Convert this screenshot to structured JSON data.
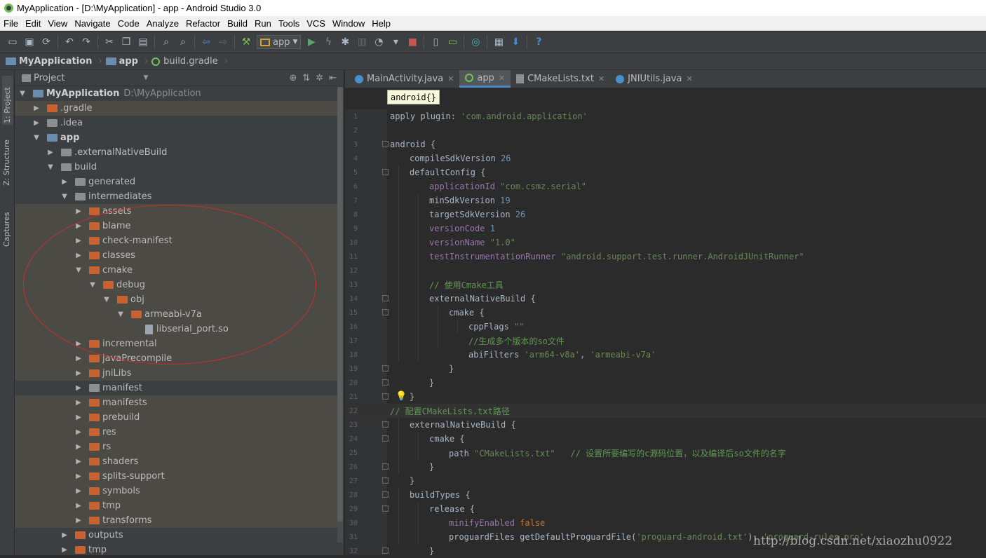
{
  "window": {
    "title": "MyApplication - [D:\\MyApplication] - app - Android Studio 3.0"
  },
  "menu": [
    "File",
    "Edit",
    "View",
    "Navigate",
    "Code",
    "Analyze",
    "Refactor",
    "Build",
    "Run",
    "Tools",
    "VCS",
    "Window",
    "Help"
  ],
  "toolbar": {
    "run_config": "app",
    "help": "?"
  },
  "breadcrumb": {
    "project": "MyApplication",
    "module": "app",
    "file": "build.gradle"
  },
  "side_tabs": {
    "project": "1: Project",
    "structure": "Z: Structure",
    "captures": "Captures"
  },
  "project_panel": {
    "view": "Project"
  },
  "tree": [
    {
      "label": "MyApplication",
      "path": "D:\\MyApplication",
      "depth": 0,
      "state": "open",
      "icon": "module"
    },
    {
      "label": ".gradle",
      "depth": 1,
      "state": "closed",
      "icon": "orange-folder"
    },
    {
      "label": ".idea",
      "depth": 1,
      "state": "closed",
      "icon": "folder"
    },
    {
      "label": "app",
      "depth": 1,
      "state": "open",
      "icon": "module"
    },
    {
      "label": ".externalNativeBuild",
      "depth": 2,
      "state": "closed",
      "icon": "folder"
    },
    {
      "label": "build",
      "depth": 2,
      "state": "open",
      "icon": "folder"
    },
    {
      "label": "generated",
      "depth": 3,
      "state": "closed",
      "icon": "folder"
    },
    {
      "label": "intermediates",
      "depth": 3,
      "state": "open",
      "icon": "folder"
    },
    {
      "label": "assets",
      "depth": 4,
      "state": "closed",
      "icon": "orange-folder"
    },
    {
      "label": "blame",
      "depth": 4,
      "state": "closed",
      "icon": "orange-folder"
    },
    {
      "label": "check-manifest",
      "depth": 4,
      "state": "closed",
      "icon": "orange-folder"
    },
    {
      "label": "classes",
      "depth": 4,
      "state": "closed",
      "icon": "orange-folder"
    },
    {
      "label": "cmake",
      "depth": 4,
      "state": "open",
      "icon": "orange-folder"
    },
    {
      "label": "debug",
      "depth": 5,
      "state": "open",
      "icon": "orange-folder"
    },
    {
      "label": "obj",
      "depth": 6,
      "state": "open",
      "icon": "orange-folder"
    },
    {
      "label": "armeabi-v7a",
      "depth": 7,
      "state": "open",
      "icon": "orange-folder"
    },
    {
      "label": "libserial_port.so",
      "depth": 8,
      "state": "leaf",
      "icon": "so-file"
    },
    {
      "label": "incremental",
      "depth": 4,
      "state": "closed",
      "icon": "orange-folder"
    },
    {
      "label": "javaPrecompile",
      "depth": 4,
      "state": "closed",
      "icon": "orange-folder"
    },
    {
      "label": "jniLibs",
      "depth": 4,
      "state": "closed",
      "icon": "orange-folder"
    },
    {
      "label": "manifest",
      "depth": 4,
      "state": "closed",
      "icon": "folder"
    },
    {
      "label": "manifests",
      "depth": 4,
      "state": "closed",
      "icon": "orange-folder"
    },
    {
      "label": "prebuild",
      "depth": 4,
      "state": "closed",
      "icon": "orange-folder"
    },
    {
      "label": "res",
      "depth": 4,
      "state": "closed",
      "icon": "orange-folder"
    },
    {
      "label": "rs",
      "depth": 4,
      "state": "closed",
      "icon": "orange-folder"
    },
    {
      "label": "shaders",
      "depth": 4,
      "state": "closed",
      "icon": "orange-folder"
    },
    {
      "label": "splits-support",
      "depth": 4,
      "state": "closed",
      "icon": "orange-folder"
    },
    {
      "label": "symbols",
      "depth": 4,
      "state": "closed",
      "icon": "orange-folder"
    },
    {
      "label": "tmp",
      "depth": 4,
      "state": "closed",
      "icon": "orange-folder"
    },
    {
      "label": "transforms",
      "depth": 4,
      "state": "closed",
      "icon": "orange-folder"
    },
    {
      "label": "outputs",
      "depth": 3,
      "state": "closed",
      "icon": "orange-folder"
    },
    {
      "label": "tmp",
      "depth": 3,
      "state": "closed",
      "icon": "orange-folder"
    }
  ],
  "editor_tabs": [
    {
      "label": "MainActivity.java",
      "icon": "class-icon",
      "active": false
    },
    {
      "label": "app",
      "icon": "gradle-icon",
      "active": true
    },
    {
      "label": "CMakeLists.txt",
      "icon": "text-file-icon",
      "active": false
    },
    {
      "label": "JNIUtils.java",
      "icon": "class-icon",
      "active": false
    }
  ],
  "structure_hint": "android{}",
  "code": [
    {
      "n": "1",
      "indent": 0,
      "parts": [
        [
          "t",
          "apply plugin: "
        ],
        [
          "s",
          "'com.android.application'"
        ]
      ]
    },
    {
      "n": "2",
      "indent": 0,
      "parts": []
    },
    {
      "n": "3",
      "indent": 0,
      "parts": [
        [
          "t",
          "android {"
        ]
      ]
    },
    {
      "n": "4",
      "indent": 1,
      "parts": [
        [
          "t",
          "compileSdkVersion "
        ],
        [
          "n",
          "26"
        ]
      ]
    },
    {
      "n": "5",
      "indent": 1,
      "parts": [
        [
          "t",
          "defaultConfig {"
        ]
      ]
    },
    {
      "n": "6",
      "indent": 2,
      "parts": [
        [
          "p",
          "applicationId "
        ],
        [
          "s",
          "\"com.csmz.serial\""
        ]
      ]
    },
    {
      "n": "7",
      "indent": 2,
      "parts": [
        [
          "t",
          "minSdkVersion "
        ],
        [
          "n",
          "19"
        ]
      ]
    },
    {
      "n": "8",
      "indent": 2,
      "parts": [
        [
          "t",
          "targetSdkVersion "
        ],
        [
          "n",
          "26"
        ]
      ]
    },
    {
      "n": "9",
      "indent": 2,
      "parts": [
        [
          "p",
          "versionCode "
        ],
        [
          "n",
          "1"
        ]
      ]
    },
    {
      "n": "10",
      "indent": 2,
      "parts": [
        [
          "p",
          "versionName "
        ],
        [
          "s",
          "\"1.0\""
        ]
      ]
    },
    {
      "n": "11",
      "indent": 2,
      "parts": [
        [
          "p",
          "testInstrumentationRunner "
        ],
        [
          "s",
          "\"android.support.test.runner.AndroidJUnitRunner\""
        ]
      ]
    },
    {
      "n": "12",
      "indent": 0,
      "parts": []
    },
    {
      "n": "13",
      "indent": 2,
      "parts": [
        [
          "c",
          "// 使用Cmake工具"
        ]
      ]
    },
    {
      "n": "14",
      "indent": 2,
      "parts": [
        [
          "t",
          "externalNativeBuild {"
        ]
      ]
    },
    {
      "n": "15",
      "indent": 3,
      "parts": [
        [
          "t",
          "cmake {"
        ]
      ]
    },
    {
      "n": "16",
      "indent": 4,
      "parts": [
        [
          "t",
          "cppFlags "
        ],
        [
          "s",
          "\"\""
        ]
      ]
    },
    {
      "n": "17",
      "indent": 4,
      "parts": [
        [
          "c",
          "//生成多个版本的so文件"
        ]
      ]
    },
    {
      "n": "18",
      "indent": 4,
      "parts": [
        [
          "t",
          "abiFilters "
        ],
        [
          "s",
          "'arm64-v8a'"
        ],
        [
          "t",
          ", "
        ],
        [
          "s",
          "'armeabi-v7a'"
        ]
      ]
    },
    {
      "n": "19",
      "indent": 3,
      "parts": [
        [
          "t",
          "}"
        ]
      ]
    },
    {
      "n": "20",
      "indent": 2,
      "parts": [
        [
          "t",
          "}"
        ]
      ]
    },
    {
      "n": "21",
      "indent": 1,
      "parts": [
        [
          "t",
          "}"
        ]
      ]
    },
    {
      "n": "22",
      "indent": 0,
      "parts": [
        [
          "c",
          "// 配置CMakeLists.txt路径"
        ]
      ]
    },
    {
      "n": "23",
      "indent": 1,
      "parts": [
        [
          "t",
          "externalNativeBuild {"
        ]
      ]
    },
    {
      "n": "24",
      "indent": 2,
      "parts": [
        [
          "t",
          "cmake {"
        ]
      ]
    },
    {
      "n": "25",
      "indent": 3,
      "parts": [
        [
          "t",
          "path "
        ],
        [
          "s",
          "\"CMakeLists.txt\""
        ],
        [
          "t",
          "   "
        ],
        [
          "c",
          "// 设置所要编写的c源码位置，以及编译后so文件的名字"
        ]
      ]
    },
    {
      "n": "26",
      "indent": 2,
      "parts": [
        [
          "t",
          "}"
        ]
      ]
    },
    {
      "n": "27",
      "indent": 1,
      "parts": [
        [
          "t",
          "}"
        ]
      ]
    },
    {
      "n": "28",
      "indent": 1,
      "parts": [
        [
          "t",
          "buildTypes {"
        ]
      ]
    },
    {
      "n": "29",
      "indent": 2,
      "parts": [
        [
          "t",
          "release {"
        ]
      ]
    },
    {
      "n": "30",
      "indent": 3,
      "parts": [
        [
          "p",
          "minifyEnabled "
        ],
        [
          "k",
          "false"
        ]
      ]
    },
    {
      "n": "31",
      "indent": 3,
      "parts": [
        [
          "t",
          "proguardFiles getDefaultProguardFile("
        ],
        [
          "s",
          "'proguard-android.txt'"
        ],
        [
          "t",
          "), "
        ],
        [
          "s",
          "'proguard-rules.pro'"
        ]
      ]
    },
    {
      "n": "32",
      "indent": 2,
      "parts": [
        [
          "t",
          "}"
        ]
      ]
    }
  ],
  "watermark": "http://blog.csdn.net/xiaozhu0922",
  "colors": {
    "accent": "#4a88c7",
    "annotation": "#c8302d",
    "bg": "#2b2b2b"
  }
}
